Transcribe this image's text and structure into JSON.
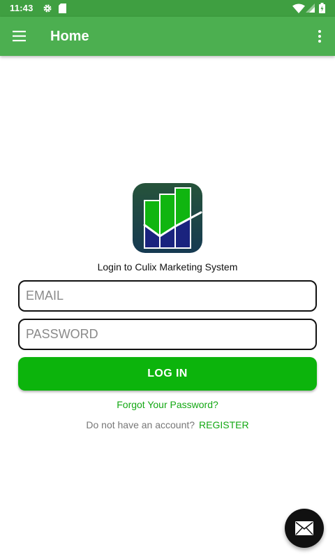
{
  "status_bar": {
    "time": "11:43",
    "icons": [
      "gear-icon",
      "sd-card-icon",
      "wifi-icon",
      "signal-icon",
      "battery-icon"
    ]
  },
  "app_bar": {
    "title": "Home",
    "menu_icon": "hamburger-menu-icon",
    "overflow_icon": "more-vert-icon",
    "background_color": "#4caf50"
  },
  "login": {
    "logo_icon": "culix-chart-logo-icon",
    "caption": "Login to Culix Marketing System",
    "email_placeholder": "EMAIL",
    "email_value": "",
    "password_placeholder": "PASSWORD",
    "password_value": "",
    "login_button": "LOG IN",
    "forgot_password": "Forgot Your Password?",
    "register_prompt": "Do not have an account?",
    "register_link": "REGISTER",
    "accent_color": "#0cb40c"
  },
  "fab": {
    "icon": "mail-icon"
  }
}
